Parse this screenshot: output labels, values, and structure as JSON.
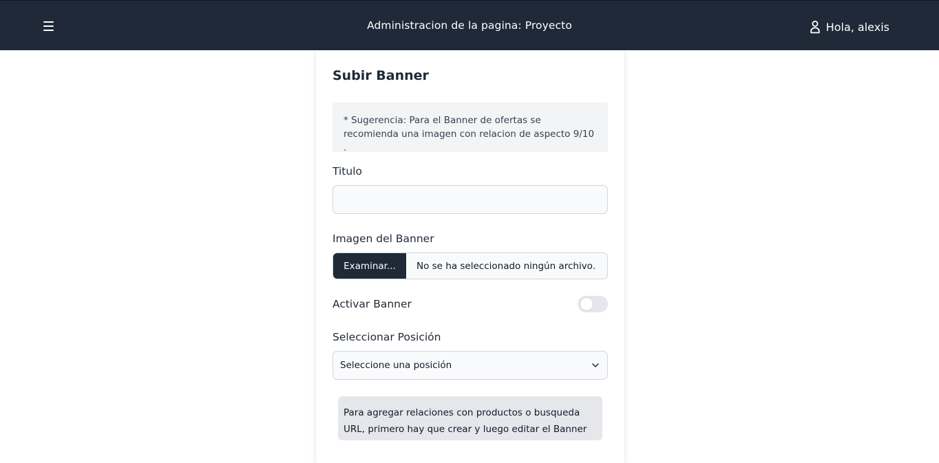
{
  "header": {
    "title": "Administracion de la pagina: Proyecto",
    "greeting": "Hola, alexis",
    "menu_icon": "hamburger-menu-icon",
    "user_icon": "user-icon",
    "background": "#1f2937"
  },
  "form": {
    "title": "Subir Banner",
    "hint": "* Sugerencia: Para el Banner de ofertas se recomienda una imagen con relacion de aspecto 9/10 .",
    "titulo_label": "Titulo",
    "titulo_value": "",
    "image_label": "Imagen del Banner",
    "browse_label": "Examinar...",
    "file_status": "No se ha seleccionado ningún archivo.",
    "activate_label": "Activar Banner",
    "activate_on": false,
    "position_label": "Seleccionar Posición",
    "position_selected": "Seleccione una posición",
    "note": "Para agregar relaciones con productos o busqueda URL, primero hay que crear y luego editar el Banner"
  }
}
